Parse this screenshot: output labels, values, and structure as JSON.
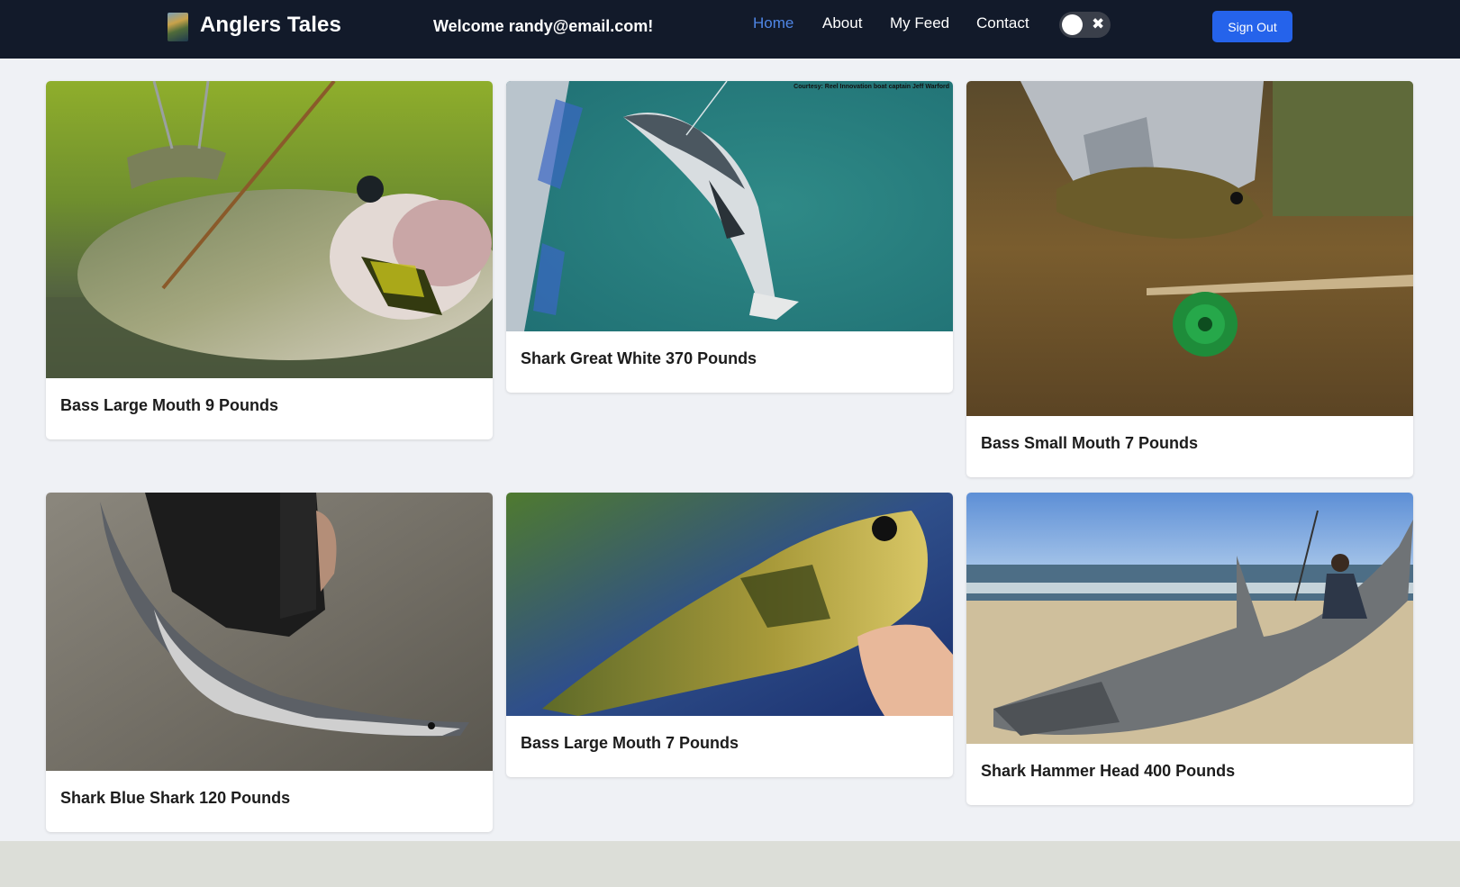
{
  "nav": {
    "brand": "Anglers Tales",
    "welcome": "Welcome randy@email.com!",
    "links": [
      {
        "label": "Home",
        "active": true
      },
      {
        "label": "About",
        "active": false
      },
      {
        "label": "My Feed",
        "active": false
      },
      {
        "label": "Contact",
        "active": false
      }
    ],
    "toggle_icon": "close-icon",
    "sign_out": "Sign Out"
  },
  "cards": [
    {
      "title": "Bass Large Mouth 9 Pounds"
    },
    {
      "title": "Shark Great White 370 Pounds",
      "photo_caption": "Courtesy: Reel Innovation boat captain Jeff Warford"
    },
    {
      "title": "Bass Small Mouth 7 Pounds"
    },
    {
      "title": "Shark Blue Shark 120 Pounds"
    },
    {
      "title": "Bass Large Mouth 7 Pounds"
    },
    {
      "title": "Shark Hammer Head 400 Pounds"
    }
  ],
  "colors": {
    "nav_bg": "#121a2a",
    "active_link": "#4f86e6",
    "button": "#2563eb",
    "page_bg": "#eff1f5"
  }
}
